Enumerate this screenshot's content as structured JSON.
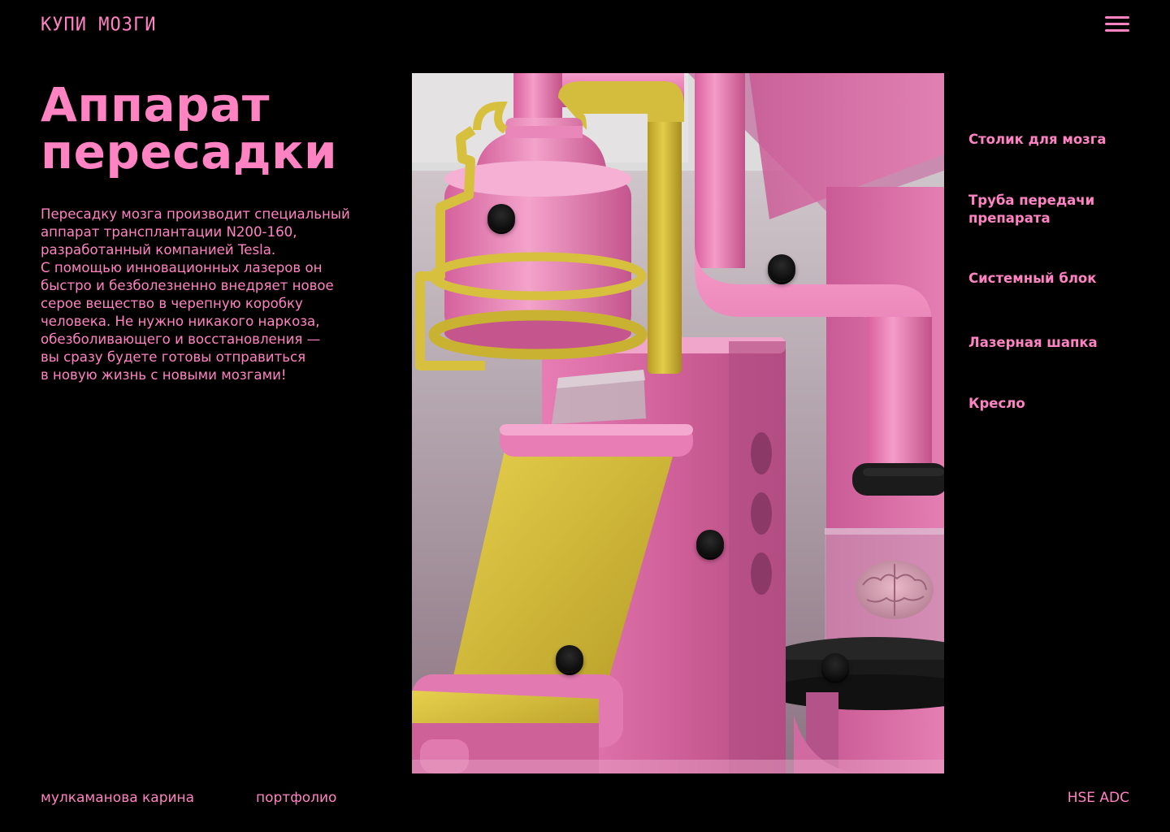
{
  "header": {
    "logo": "КУПИ МОЗГИ",
    "menu_icon": "hamburger-menu-icon"
  },
  "hero": {
    "title_line1": "Аппарат",
    "title_line2": "пересадки",
    "description": [
      "Пересадку мозга производит специальный",
      "аппарат трансплантации N200-160,",
      "разработанный компанией Tesla.",
      "С помощью инновационных лазеров он",
      "быстро и безболезненно внедряет новое",
      "серое вещество в черепную коробку",
      "человека. Не нужно никакого наркоза,",
      "обезболивающего и восстановления —",
      "вы сразу будете готовы отправиться",
      "в новую жизнь с новыми мозгами!"
    ]
  },
  "parts": [
    {
      "label": "Столик для мозга"
    },
    {
      "label": "Труба передачи препарата"
    },
    {
      "label": "Системный блок"
    },
    {
      "label": "Лазерная шапка"
    },
    {
      "label": "Кресло"
    }
  ],
  "footer": {
    "author": "мулкаманова карина",
    "portfolio": "портфолио",
    "school": "HSE ADC"
  },
  "colors": {
    "accent": "#ff82c2",
    "background": "#000000",
    "machine_pink": "#e56aa9",
    "chair_yellow": "#d8c43a"
  }
}
